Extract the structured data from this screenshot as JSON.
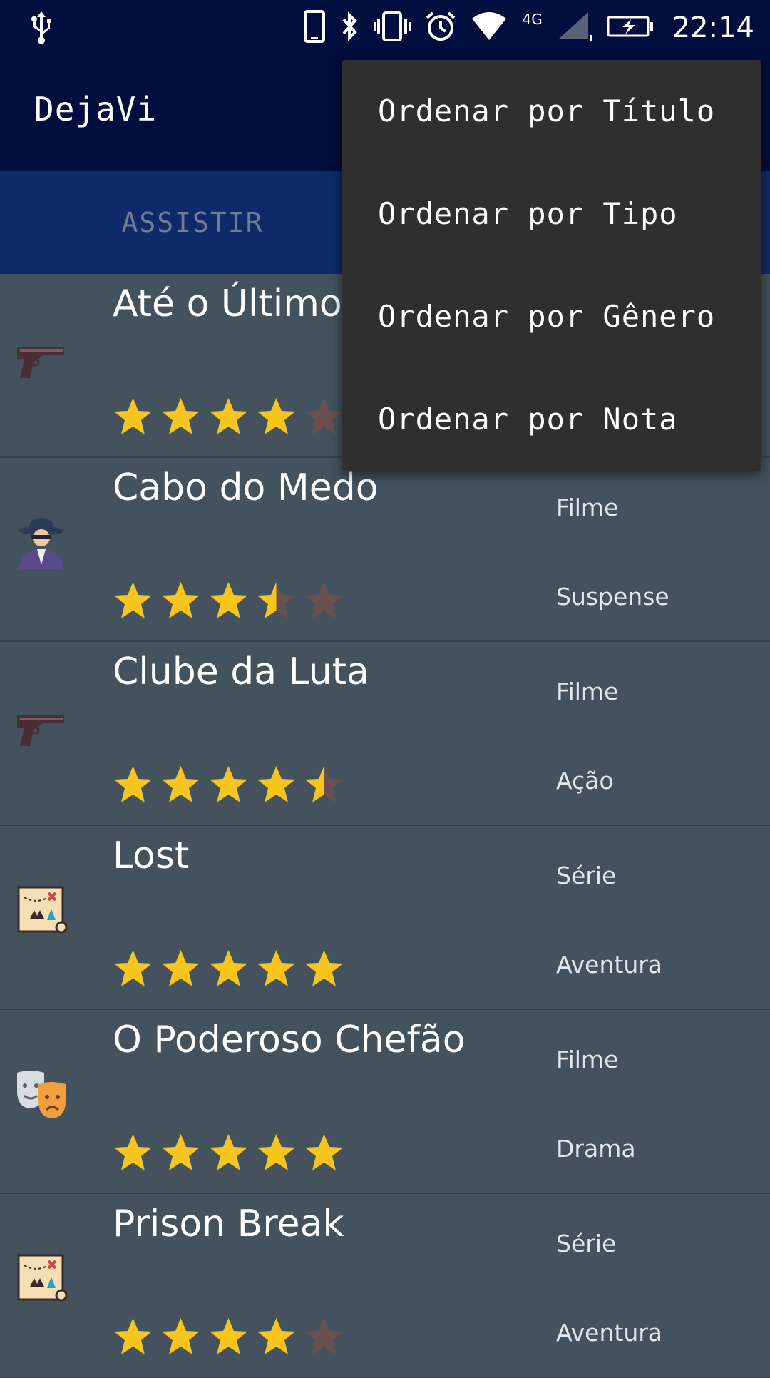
{
  "status_bar": {
    "time": "22:14",
    "network": "4G",
    "icons": [
      "usb-icon",
      "phone-icon",
      "bluetooth-icon",
      "vibrate-icon",
      "alarm-icon",
      "wifi-icon",
      "signal-icon",
      "battery-charging-icon"
    ]
  },
  "app_bar": {
    "title": "DejaVi"
  },
  "tabs": [
    {
      "label": "ASSISTIR"
    },
    {
      "label": ""
    }
  ],
  "menu": {
    "items": [
      {
        "label": "Ordenar por Título"
      },
      {
        "label": "Ordenar por Tipo"
      },
      {
        "label": "Ordenar por Gênero"
      },
      {
        "label": "Ordenar por Nota"
      }
    ]
  },
  "list": {
    "items": [
      {
        "title": "Até o Último",
        "type": "",
        "genre": "",
        "rating": 4,
        "icon": "pistol-icon"
      },
      {
        "title": "Cabo do Medo",
        "type": "Filme",
        "genre": "Suspense",
        "rating": 3.5,
        "icon": "detective-icon"
      },
      {
        "title": "Clube da Luta",
        "type": "Filme",
        "genre": "Ação",
        "rating": 4.5,
        "icon": "pistol-icon"
      },
      {
        "title": "Lost",
        "type": "Série",
        "genre": "Aventura",
        "rating": 5,
        "icon": "treasure-map-icon"
      },
      {
        "title": "O Poderoso Chefão",
        "type": "Filme",
        "genre": "Drama",
        "rating": 5,
        "icon": "theater-masks-icon"
      },
      {
        "title": "Prison Break",
        "type": "Série",
        "genre": "Aventura",
        "rating": 4,
        "icon": "treasure-map-icon"
      }
    ]
  },
  "colors": {
    "status_bar": "#010d3d",
    "app_bar": "#010d3d",
    "tab_bar": "#0e2a68",
    "list_bg": "#44525d",
    "menu_bg": "#2f2f2f",
    "star_filled": "#f7c51e",
    "star_empty": "#6b4f4f"
  }
}
